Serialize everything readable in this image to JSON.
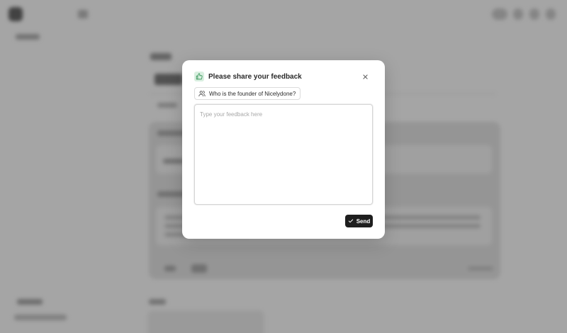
{
  "dialog": {
    "title": "Please share your feedback",
    "question": "Who is the founder of Nicelydone?",
    "feedback_placeholder": "Type your feedback here",
    "feedback_value": "",
    "send_label": "Send"
  },
  "icons": {
    "header": "thumbs-up-icon",
    "close": "close-icon",
    "question": "user-icon",
    "send": "check-icon"
  },
  "colors": {
    "accent_bg": "#d9efe0",
    "accent_icon": "#3f9a5f",
    "send_bg": "#1e1e1e"
  }
}
